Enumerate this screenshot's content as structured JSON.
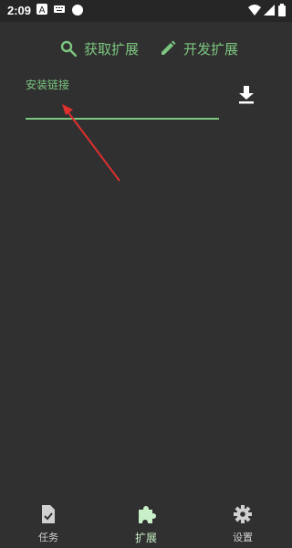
{
  "status_bar": {
    "time": "2:09",
    "icons": [
      "a-icon",
      "keyboard-icon",
      "circle-icon",
      "wifi-icon",
      "signal-icon",
      "battery-icon"
    ]
  },
  "actions": {
    "get_extension": "获取扩展",
    "dev_extension": "开发扩展"
  },
  "install": {
    "label": "安装链接",
    "value": ""
  },
  "bottom_nav": {
    "items": [
      {
        "label": "任务",
        "icon": "task-icon",
        "active": false
      },
      {
        "label": "扩展",
        "icon": "puzzle-icon",
        "active": true
      },
      {
        "label": "设置",
        "icon": "gear-icon",
        "active": false
      }
    ]
  },
  "colors": {
    "accent": "#7cc67f",
    "background": "#303030",
    "active_nav": "#c8f0c8",
    "annotation": "#e0302f"
  }
}
